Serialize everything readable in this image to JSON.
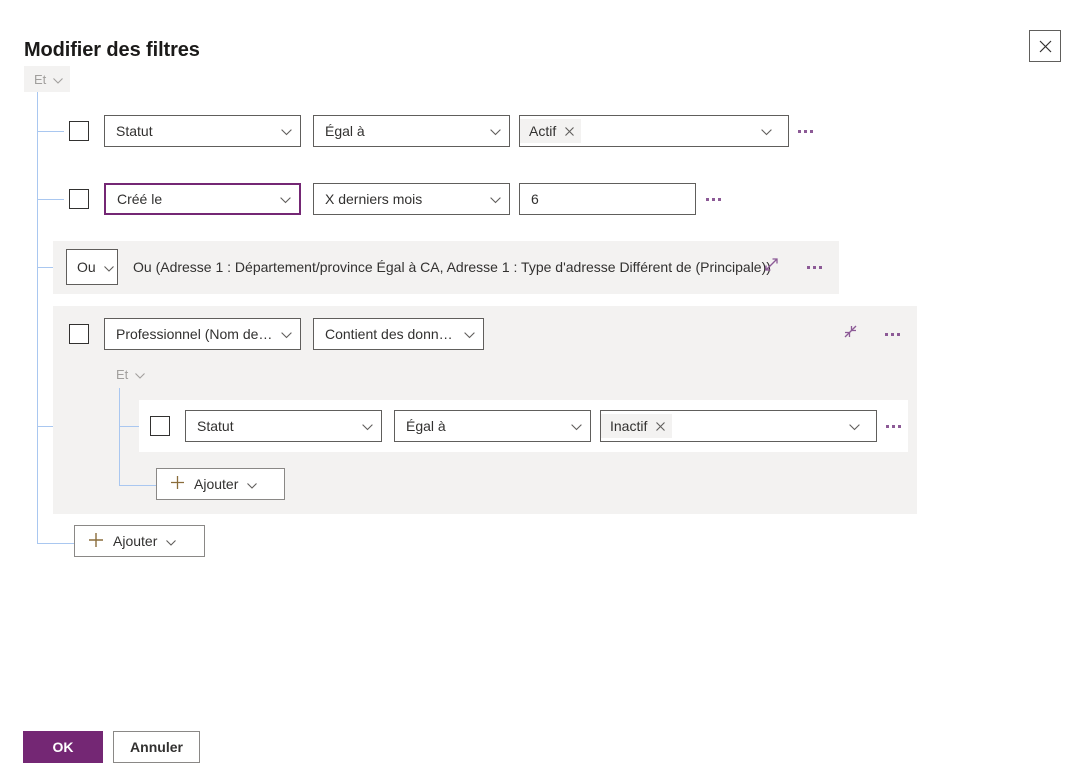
{
  "dialog": {
    "title": "Modifier des filtres",
    "close_icon": "close-icon"
  },
  "root_group": {
    "conjunction": "Et"
  },
  "colors": {
    "accent_purple": "#742774",
    "ellipsis_purple": "#8c5a96",
    "tree_line": "#a9c7f0",
    "panel_gray": "#f3f2f1"
  },
  "rows": {
    "row1": {
      "field": "Statut",
      "operator": "Égal à",
      "value_tag": "Actif",
      "tag_remove_icon": "close-icon",
      "menu_icon": "more-options-icon"
    },
    "row2": {
      "field": "Créé le",
      "operator": "X derniers mois",
      "value": "6",
      "menu_icon": "more-options-icon"
    }
  },
  "collapsed_group": {
    "conjunction": "Ou",
    "summary": "Ou (Adresse 1 : Département/province Égal à CA, Adresse 1 : Type d'adresse Différent de (Principale))",
    "expand_icon": "expand-icon",
    "menu_icon": "more-options-icon"
  },
  "related_group": {
    "field": "Professionnel (Nom de l...",
    "operator": "Contient des données",
    "collapse_icon": "collapse-icon",
    "menu_icon": "more-options-icon",
    "conjunction": "Et",
    "child_row": {
      "field": "Statut",
      "operator": "Égal à",
      "value_tag": "Inactif",
      "tag_remove_icon": "close-icon",
      "menu_icon": "more-options-icon"
    },
    "add_label": "Ajouter"
  },
  "add_label": "Ajouter",
  "footer": {
    "ok_label": "OK",
    "cancel_label": "Annuler"
  }
}
